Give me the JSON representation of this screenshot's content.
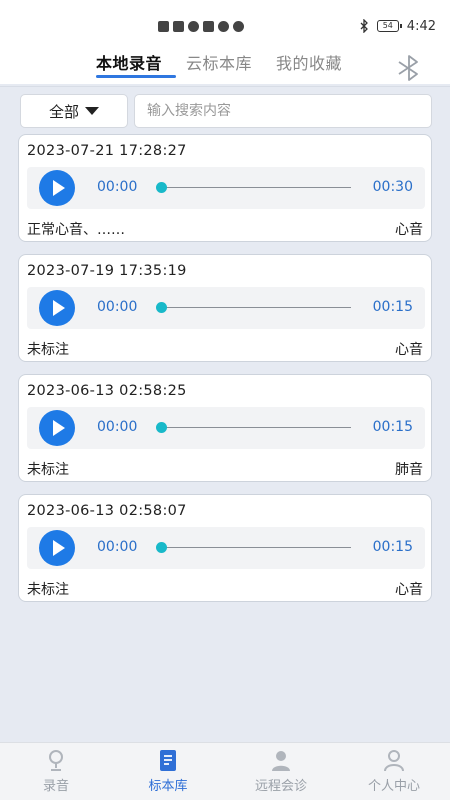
{
  "status_bar": {
    "time": "4:42",
    "battery": "54"
  },
  "header": {
    "tabs": [
      {
        "label": "本地录音",
        "active": true
      },
      {
        "label": "云标本库",
        "active": false
      },
      {
        "label": "我的收藏",
        "active": false
      }
    ],
    "bluetooth_icon": "bluetooth-icon"
  },
  "filter": {
    "selected": "全部",
    "search_placeholder": "输入搜索内容"
  },
  "recordings": [
    {
      "datetime": "2023-07-21 17:28:27",
      "current": "00:00",
      "duration": "00:30",
      "label": "正常心音、……",
      "type": "心音"
    },
    {
      "datetime": "2023-07-19 17:35:19",
      "current": "00:00",
      "duration": "00:15",
      "label": "未标注",
      "type": "心音"
    },
    {
      "datetime": "2023-06-13 02:58:25",
      "current": "00:00",
      "duration": "00:15",
      "label": "未标注",
      "type": "肺音"
    },
    {
      "datetime": "2023-06-13 02:58:07",
      "current": "00:00",
      "duration": "00:15",
      "label": "未标注",
      "type": "心音"
    }
  ],
  "bottom_nav": [
    {
      "label": "录音",
      "icon": "stethoscope-icon",
      "active": false
    },
    {
      "label": "标本库",
      "icon": "document-icon",
      "active": true
    },
    {
      "label": "远程会诊",
      "icon": "doctor-icon",
      "active": false
    },
    {
      "label": "个人中心",
      "icon": "person-icon",
      "active": false
    }
  ],
  "colors": {
    "accent": "#2f77e0",
    "play_button": "#1e7ae6",
    "progress_knob": "#19b9c9",
    "background": "#e6eaf2"
  }
}
